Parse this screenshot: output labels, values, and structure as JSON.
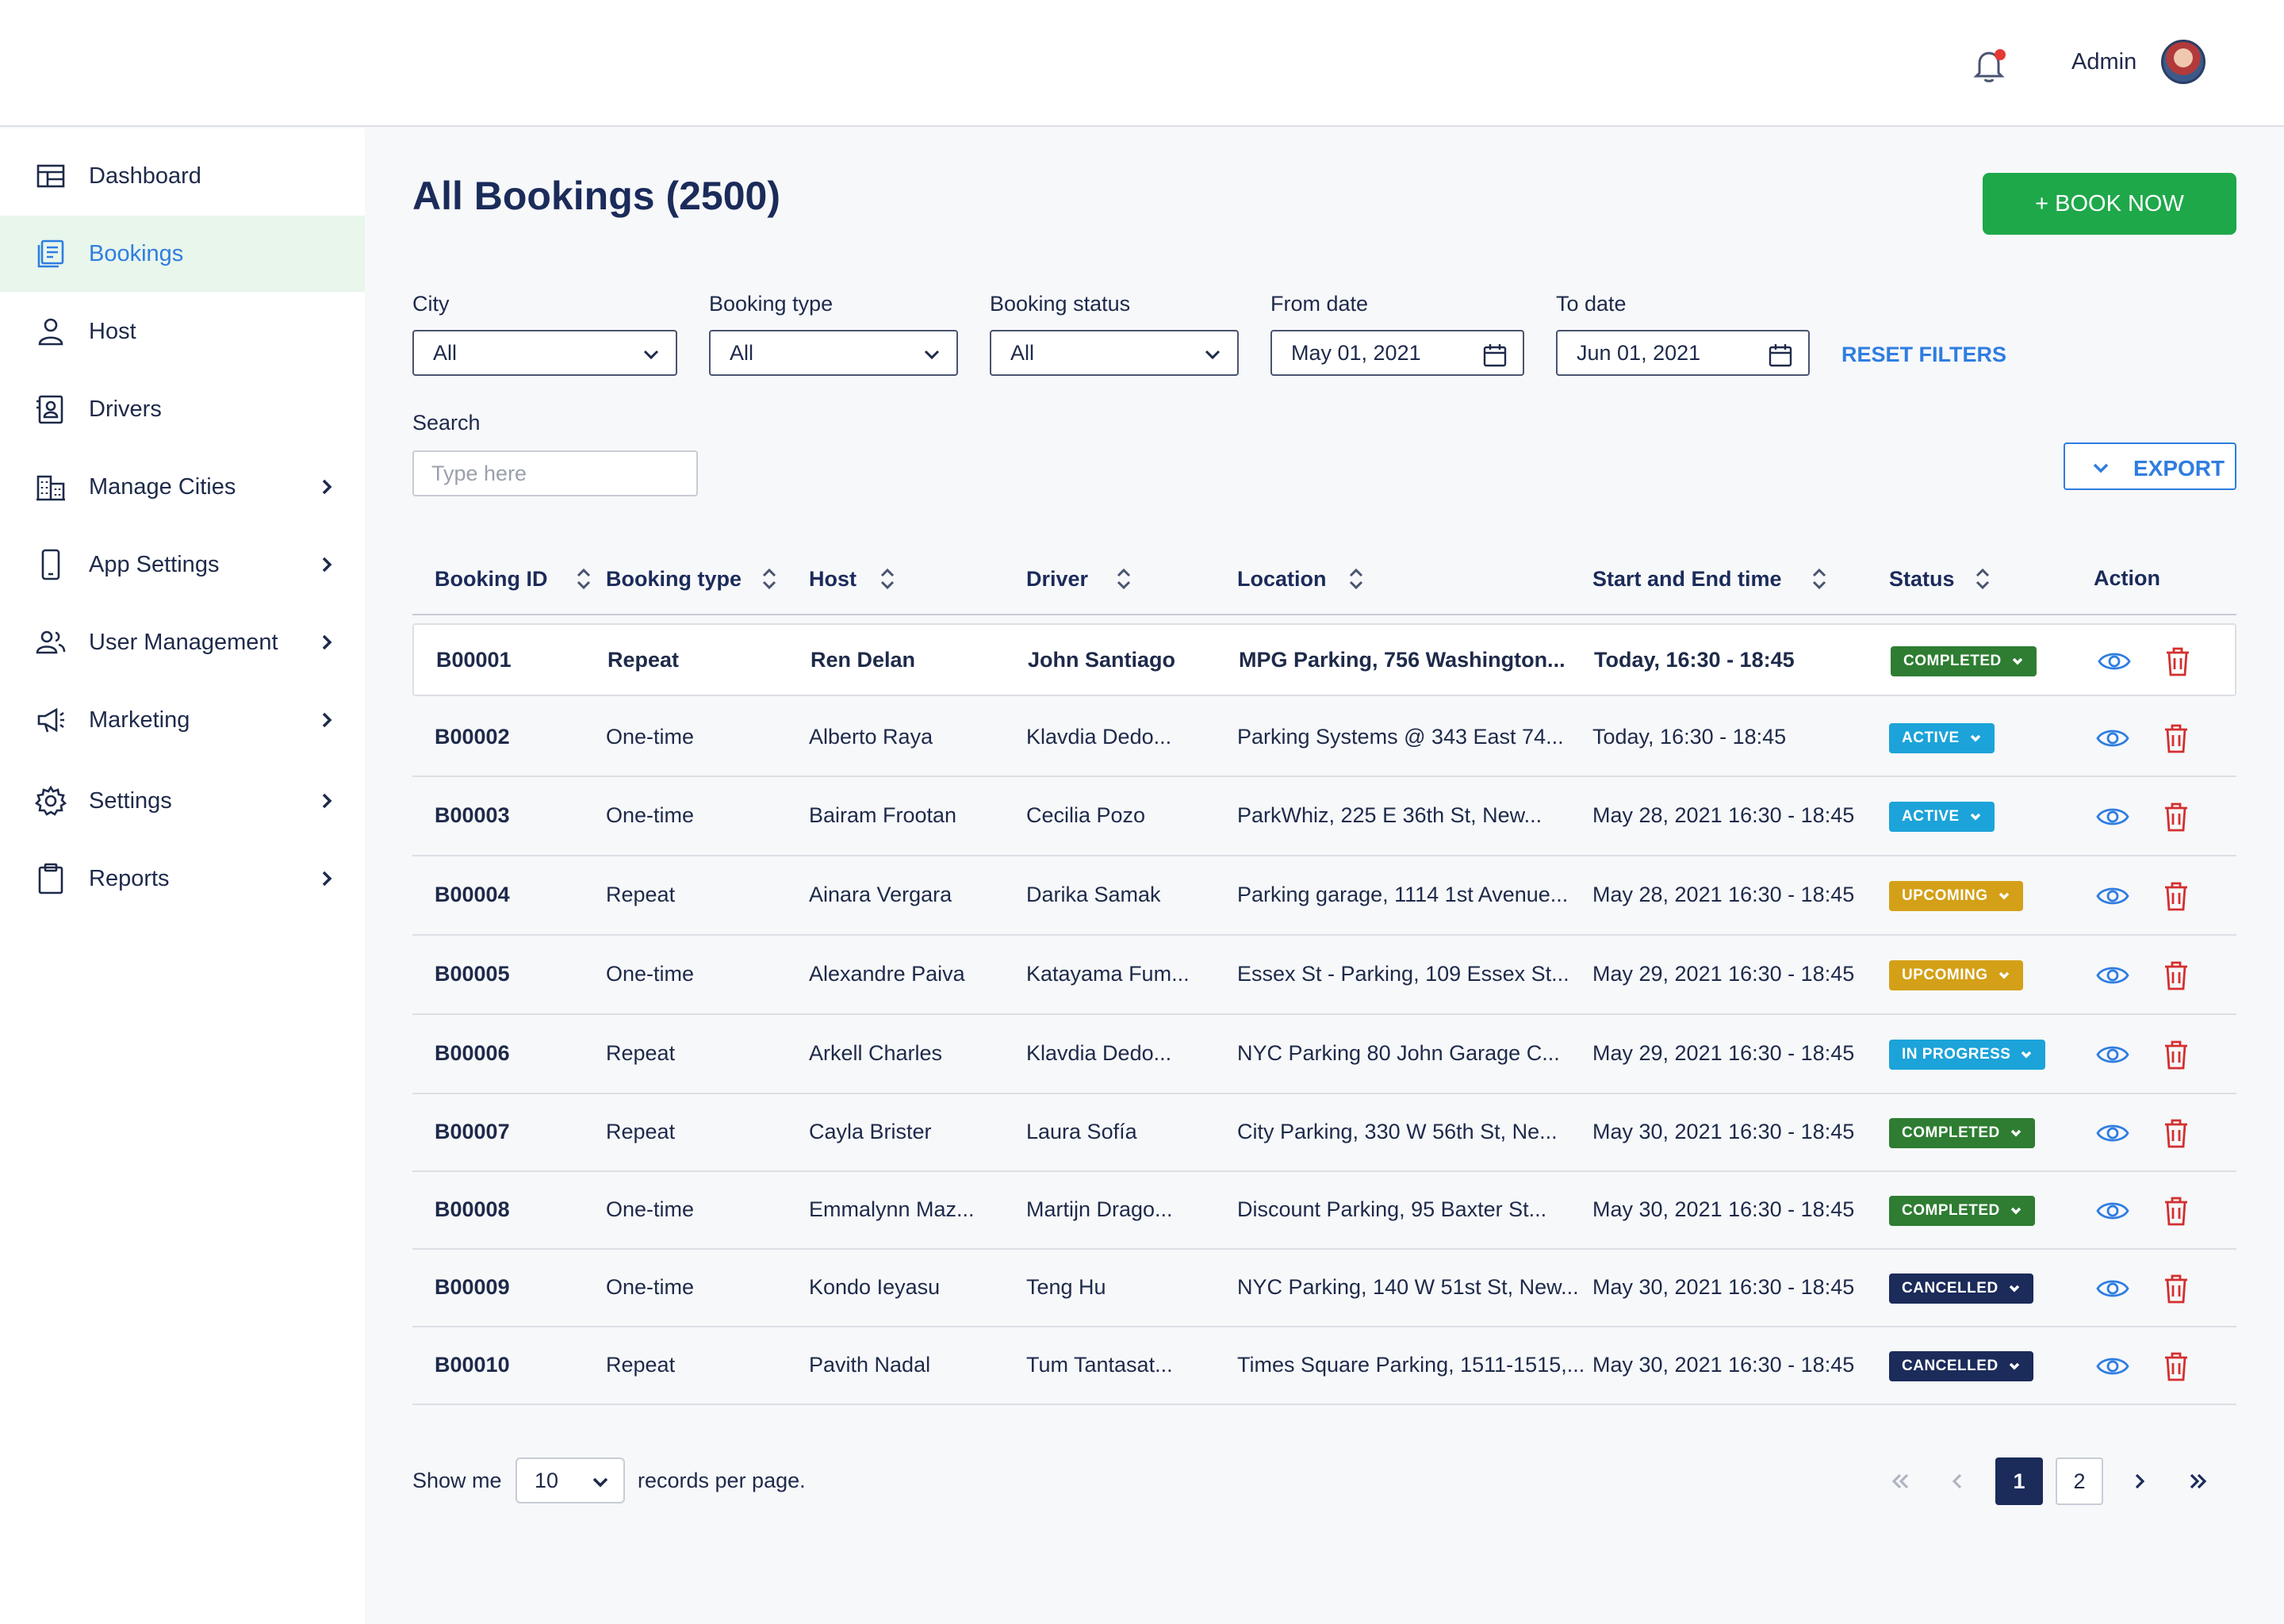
{
  "header": {
    "user_name": "Admin",
    "notification_icon": "bell-icon",
    "has_notification": true
  },
  "sidebar": {
    "items": [
      {
        "label": "Dashboard",
        "icon": "dashboard-icon",
        "active": false,
        "has_submenu": false
      },
      {
        "label": "Bookings",
        "icon": "bookings-icon",
        "active": true,
        "has_submenu": false
      },
      {
        "label": "Host",
        "icon": "person-icon",
        "active": false,
        "has_submenu": false
      },
      {
        "label": "Drivers",
        "icon": "id-card-icon",
        "active": false,
        "has_submenu": false
      },
      {
        "label": "Manage Cities",
        "icon": "city-icon",
        "active": false,
        "has_submenu": true
      },
      {
        "label": "App Settings",
        "icon": "phone-icon",
        "active": false,
        "has_submenu": true
      },
      {
        "label": "User Management",
        "icon": "users-icon",
        "active": false,
        "has_submenu": true
      },
      {
        "label": "Marketing",
        "icon": "megaphone-icon",
        "active": false,
        "has_submenu": true
      },
      {
        "label": "Settings",
        "icon": "gear-icon",
        "active": false,
        "has_submenu": true
      },
      {
        "label": "Reports",
        "icon": "clipboard-icon",
        "active": false,
        "has_submenu": true
      }
    ]
  },
  "page": {
    "title": "All Bookings (2500)",
    "book_button": "+ BOOK NOW"
  },
  "filters": {
    "city": {
      "label": "City",
      "value": "All"
    },
    "booking_type": {
      "label": "Booking type",
      "value": "All"
    },
    "booking_status": {
      "label": "Booking status",
      "value": "All"
    },
    "from_date": {
      "label": "From date",
      "value": "May 01, 2021"
    },
    "to_date": {
      "label": "To date",
      "value": "Jun 01, 2021"
    },
    "reset_label": "RESET FILTERS",
    "search": {
      "label": "Search",
      "placeholder": "Type here"
    },
    "export_label": "EXPORT"
  },
  "table": {
    "columns": [
      "Booking ID",
      "Booking type",
      "Host",
      "Driver",
      "Location",
      "Start and End time",
      "Status",
      "Action"
    ],
    "rows": [
      {
        "id": "B00001",
        "type": "Repeat",
        "host": "Ren Delan",
        "driver": "John Santiago",
        "location": "MPG Parking, 756 Washington...",
        "time": "Today, 16:30 - 18:45",
        "status": "COMPLETED",
        "bold": true
      },
      {
        "id": "B00002",
        "type": "One-time",
        "host": "Alberto Raya",
        "driver": "Klavdia Dedo...",
        "location": "Parking Systems @ 343 East 74...",
        "time": "Today, 16:30 - 18:45",
        "status": "ACTIVE",
        "bold": false
      },
      {
        "id": "B00003",
        "type": "One-time",
        "host": "Bairam Frootan",
        "driver": "Cecilia Pozo",
        "location": "ParkWhiz, 225 E 36th St, New...",
        "time": "May 28, 2021 16:30 - 18:45",
        "status": "ACTIVE",
        "bold": false
      },
      {
        "id": "B00004",
        "type": "Repeat",
        "host": "Ainara Vergara",
        "driver": "Darika Samak",
        "location": "Parking garage, 1114 1st Avenue...",
        "time": "May 28, 2021 16:30 - 18:45",
        "status": "UPCOMING",
        "bold": false
      },
      {
        "id": "B00005",
        "type": "One-time",
        "host": "Alexandre Paiva",
        "driver": "Katayama Fum...",
        "location": "Essex St - Parking, 109 Essex St...",
        "time": "May 29, 2021 16:30 - 18:45",
        "status": "UPCOMING",
        "bold": false
      },
      {
        "id": "B00006",
        "type": "Repeat",
        "host": "Arkell Charles",
        "driver": "Klavdia Dedo...",
        "location": "NYC Parking 80 John Garage C...",
        "time": "May 29, 2021 16:30 - 18:45",
        "status": "IN PROGRESS",
        "bold": false
      },
      {
        "id": "B00007",
        "type": "Repeat",
        "host": "Cayla Brister",
        "driver": "Laura Sofía",
        "location": "City Parking, 330 W 56th St, Ne...",
        "time": "May 30, 2021 16:30 - 18:45",
        "status": "COMPLETED",
        "bold": false
      },
      {
        "id": "B00008",
        "type": "One-time",
        "host": "Emmalynn Maz...",
        "driver": "Martijn Drago...",
        "location": "Discount Parking, 95 Baxter St...",
        "time": "May 30, 2021 16:30 - 18:45",
        "status": "COMPLETED",
        "bold": false
      },
      {
        "id": "B00009",
        "type": "One-time",
        "host": "Kondo Ieyasu",
        "driver": "Teng Hu",
        "location": "NYC Parking, 140 W 51st St, New...",
        "time": "May 30, 2021 16:30 - 18:45",
        "status": "CANCELLED",
        "bold": false
      },
      {
        "id": "B00010",
        "type": "Repeat",
        "host": "Pavith Nadal",
        "driver": "Tum Tantasat...",
        "location": "Times Square Parking, 1511-1515,...",
        "time": "May 30, 2021 16:30 - 18:45",
        "status": "CANCELLED",
        "bold": false
      }
    ]
  },
  "status_colors": {
    "COMPLETED": "#2e7d32",
    "ACTIVE": "#1ca3d9",
    "UPCOMING": "#d4a017",
    "IN PROGRESS": "#1ca3d9",
    "CANCELLED": "#1b2b5a"
  },
  "pagination": {
    "show_label": "Show me",
    "per_page": "10",
    "records_label": "records per page.",
    "pages": [
      "1",
      "2"
    ],
    "current_page": "1"
  },
  "colors": {
    "accent": "#2f7de1",
    "primary_button": "#1ea84a",
    "view_icon": "#2f7de1",
    "delete_icon": "#d32f2f"
  }
}
